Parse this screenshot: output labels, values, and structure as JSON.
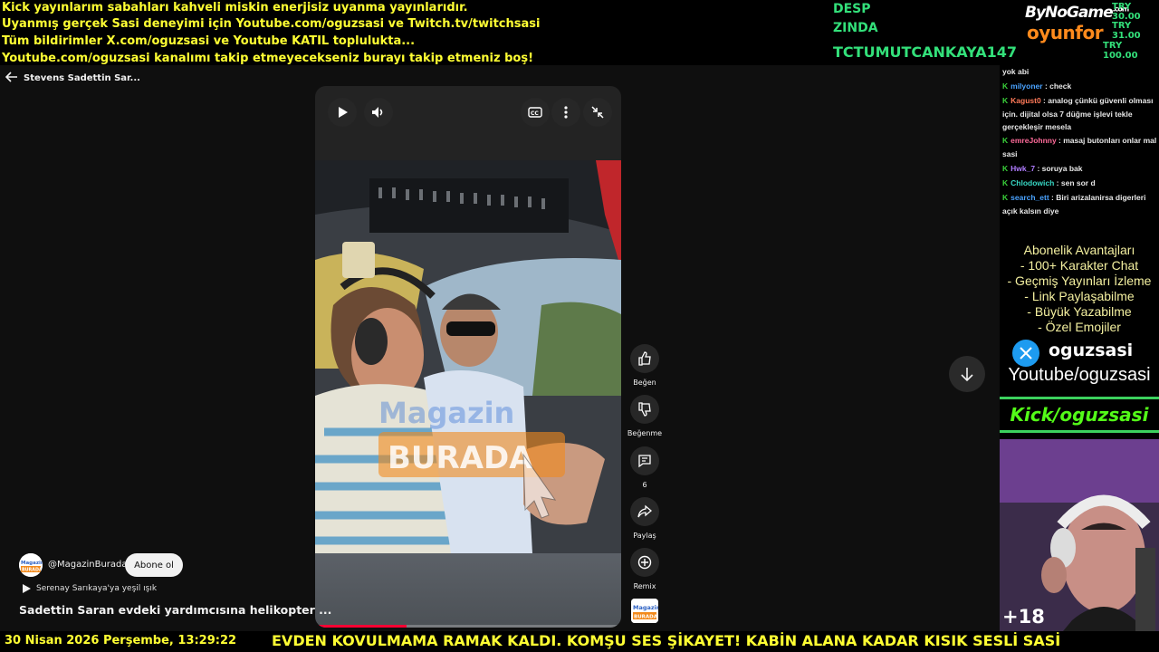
{
  "banner": {
    "lines": [
      "Kick yayınlarım sabahları kahveli miskin enerjisiz uyanma yayınlarıdır.",
      "Uyanmış gerçek Sasi deneyimi için Youtube.com/oguzsasi ve Twitch.tv/twitchsasi",
      "Tüm bildirimler X.com/oguzsasi ve Youtube KATIL toplulukta...",
      "Youtube.com/oguzsasi kanalımı takip etmeyecekseniz burayı takip etmeniz boş!"
    ],
    "donors": [
      "DESP",
      "ZINDA",
      "TCTUMUTCANKAYA147"
    ],
    "brand_top": "ByNoGame",
    "brand_top_sup": ".com",
    "brand_bottom": "oyunfor",
    "prices": [
      "TRY 30.00",
      "TRY 31.00",
      "TRY 100.00"
    ]
  },
  "nav": {
    "back_label": "Stevens Sadettin Sar..."
  },
  "video": {
    "watermark_top": "Magazin",
    "watermark_bottom": "BURADA",
    "progress": 0.3
  },
  "actions": {
    "like_label": "Beğen",
    "dislike_label": "Beğenme",
    "comments_count": "6",
    "share_label": "Paylaş",
    "remix_label": "Remix"
  },
  "channel": {
    "handle": "@MagazinBurada",
    "subscribe_label": "Abone ol",
    "music": "Serenay Sarıkaya'ya yeşil ışık",
    "title": "Sadettin Saran evdeki yardımcısına helikopter ...",
    "logo_text_1": "Magazin",
    "logo_text_2": "BURADA"
  },
  "chat": {
    "messages": [
      {
        "user": "",
        "user_color": "#e8e8e8",
        "text": "yok abi",
        "badge": false
      },
      {
        "user": "milyoner",
        "user_color": "#4aa3ff",
        "text": " : check",
        "badge": true
      },
      {
        "user": "Kagust0",
        "user_color": "#ff7a59",
        "text": " : analog çünkü güvenli olması için. dijital olsa 7 düğme işlevi tekle gerçekleşir mesela",
        "badge": true
      },
      {
        "user": "emreJohnny",
        "user_color": "#ff6b9a",
        "text": " : masaj butonları onlar mal sasi",
        "badge": true
      },
      {
        "user": "Hwk_7",
        "user_color": "#b07cff",
        "text": " : soruya bak",
        "badge": true
      },
      {
        "user": "Chlodowich",
        "user_color": "#38d9c6",
        "text": " : sen sor d",
        "badge": true
      },
      {
        "user": "search_ett",
        "user_color": "#4aa3ff",
        "text": " : Biri arizalanirsa digerleri açık kalsın diye",
        "badge": true
      }
    ],
    "badge_letter": "K"
  },
  "subscription": {
    "title": "Abonelik Avantajları",
    "perks": [
      "- 100+ Karakter Chat",
      "- Geçmiş Yayınları İzleme",
      "- Link Paylaşabilme",
      "- Büyük Yazabilme",
      "- Özel Emojiler"
    ]
  },
  "socials": {
    "x_handle": "oguzsasi",
    "youtube": "Youtube/oguzsasi",
    "kick": "Kick/oguzsasi"
  },
  "webcam": {
    "plus_count": "+18"
  },
  "ticker": {
    "datetime": "30 Nisan 2026 Perşembe, 13:29:22",
    "text": "EVDEN KOVULMAMA RAMAK KALDI. KOMŞU SES ŞİKAYET! KABİN ALANA KADAR KISIK SESLİ SASİ"
  },
  "colors": {
    "banner_yellow": "#ffff33",
    "donor_green": "#33e07a",
    "kick_green": "#53fc18",
    "progress_red": "#ff0033",
    "x_blue": "#1d9bf0"
  }
}
